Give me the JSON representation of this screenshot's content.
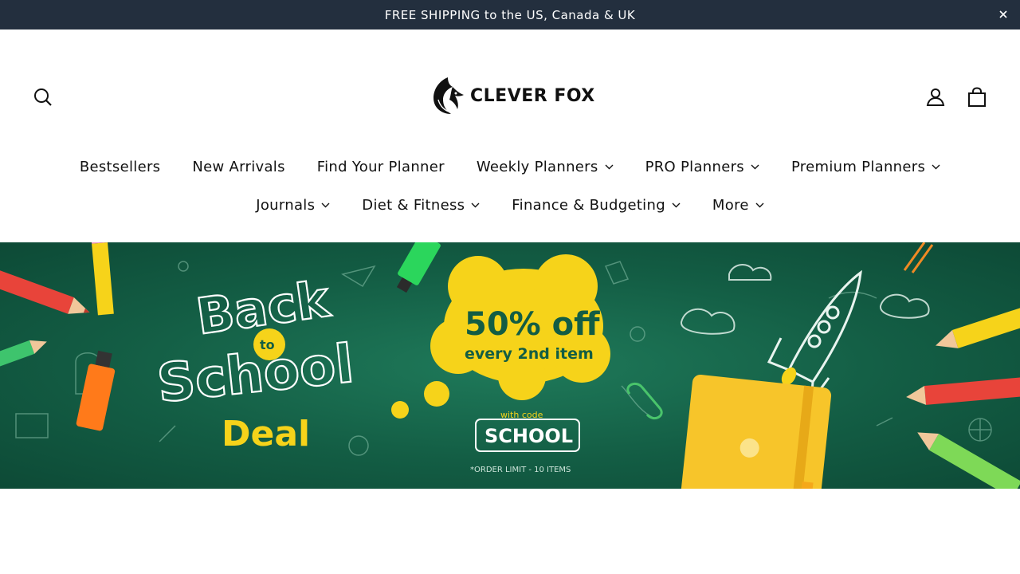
{
  "announcement": {
    "text": "FREE SHIPPING to the US, Canada & UK"
  },
  "brand": {
    "name": "CLEVER FOX"
  },
  "nav": {
    "row1": [
      {
        "label": "Bestsellers",
        "dropdown": false
      },
      {
        "label": "New Arrivals",
        "dropdown": false
      },
      {
        "label": "Find Your Planner",
        "dropdown": false
      },
      {
        "label": "Weekly Planners",
        "dropdown": true
      },
      {
        "label": "PRO Planners",
        "dropdown": true
      },
      {
        "label": "Premium Planners",
        "dropdown": true
      }
    ],
    "row2": [
      {
        "label": "Journals",
        "dropdown": true
      },
      {
        "label": "Diet & Fitness",
        "dropdown": true
      },
      {
        "label": "Finance & Budgeting",
        "dropdown": true
      },
      {
        "label": "More",
        "dropdown": true
      }
    ]
  },
  "banner": {
    "headline_line1": "Back",
    "headline_to": "to",
    "headline_line2": "School",
    "headline_deal": "Deal",
    "offer_main": "50% off",
    "offer_sub": "every 2nd item",
    "code_prefix": "with code",
    "code": "SCHOOL",
    "limit": "*ORDER LIMIT - 10 ITEMS"
  },
  "colors": {
    "announcement_bg": "#232f3e",
    "banner_green": "#135d44",
    "accent_yellow": "#f6d31a"
  },
  "icons": [
    "close-icon",
    "search-icon",
    "account-icon",
    "cart-icon",
    "chevron-down-icon",
    "fox-logo-icon"
  ]
}
